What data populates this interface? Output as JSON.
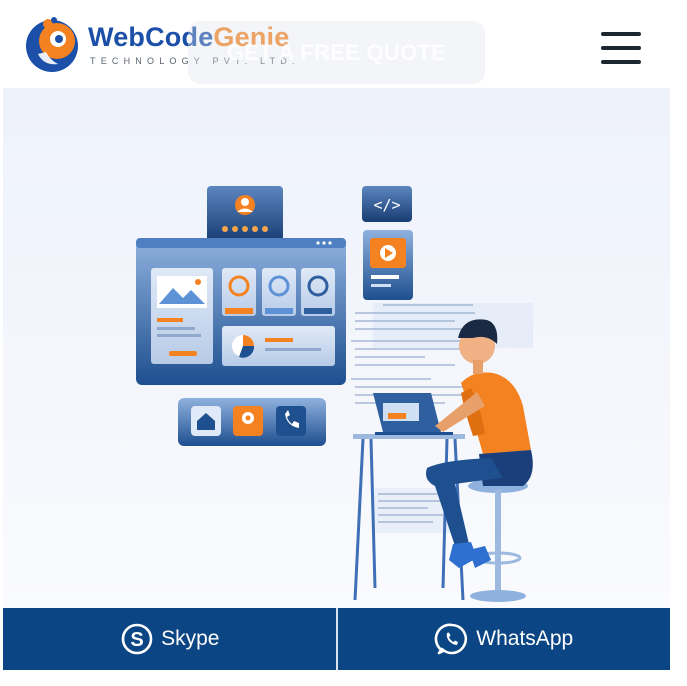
{
  "header": {
    "brand_main": "WebCode",
    "brand_accent": "Genie",
    "tagline": "TECHNOLOGY PVT. LTD.",
    "quote_button": "GET A FREE QUOTE",
    "menu_icon": "hamburger-menu-icon"
  },
  "hero": {
    "illustration": "web-developer-at-desk-illustration"
  },
  "bottom_bar": {
    "skype_label": "Skype",
    "whatsapp_label": "WhatsApp",
    "skype_icon": "skype-icon",
    "whatsapp_icon": "whatsapp-icon"
  },
  "colors": {
    "brand_blue": "#1b4fa8",
    "brand_orange": "#f58220",
    "bottom_bar": "#0c4583",
    "hero_bg": "#eef2fb"
  }
}
